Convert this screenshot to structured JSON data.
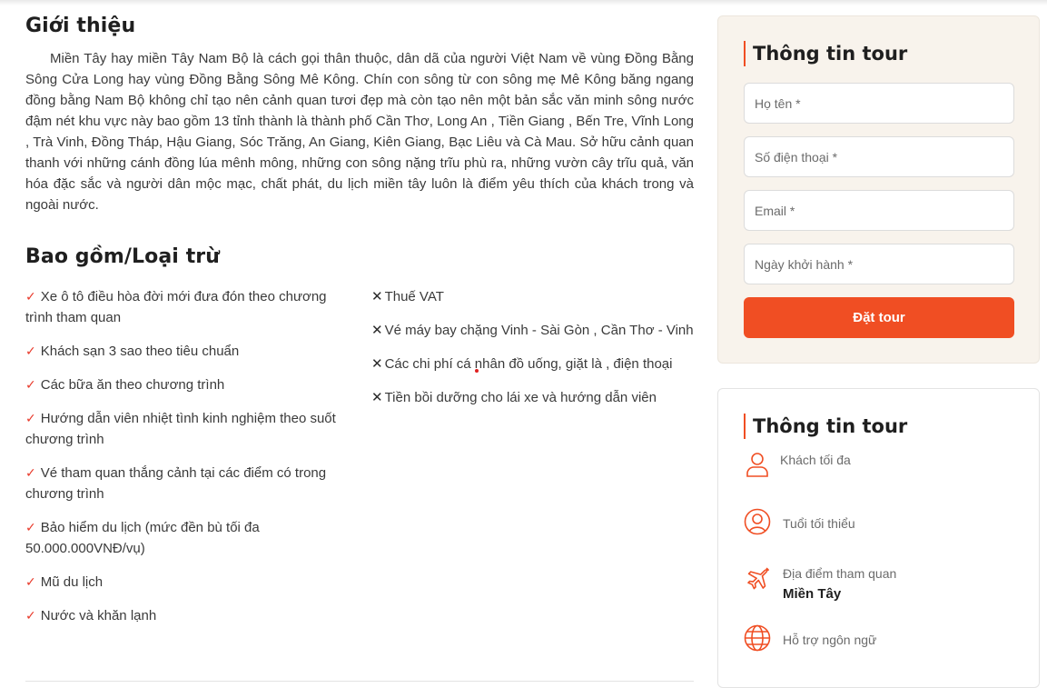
{
  "intro": {
    "title": "Giới thiệu",
    "text": "Miền Tây hay miền Tây Nam Bộ là cách gọi thân thuộc, dân dã của người Việt Nam về vùng Đồng Bằng Sông Cửa Long hay vùng Đồng Bằng Sông Mê Kông. Chín con sông  từ con sông mẹ Mê Kông băng ngang đồng bằng Nam Bộ không chỉ tạo nên cảnh quan tươi đẹp mà còn tạo nên một bản sắc văn minh sông nước đậm nét khu vực này bao gồm 13 tỉnh thành là thành phố Cần Thơ, Long An , Tiền Giang , Bến Tre, Vĩnh Long , Trà Vinh, Đồng Tháp, Hậu Giang, Sóc Trăng, An Giang, Kiên Giang, Bạc Liêu  và Cà Mau. Sở hữu cảnh quan thanh với những cánh đồng lúa mênh mông, những con sông nặng trĩu phù ra, những vườn cây trĩu quả, văn hóa đặc sắc và người dân mộc mạc, chất phát, du lịch miền tây luôn là điểm yêu thích của khách trong và ngoài nước."
  },
  "inclusions": {
    "title": "Bao gồm/Loại trừ",
    "included": [
      "Xe ô tô điều hòa đời mới đưa đón theo chương trình tham quan",
      "Khách sạn 3 sao theo tiêu chuẩn",
      "Các bữa ăn theo chương trình",
      "Hướng dẫn viên nhiệt tình kinh nghiệm theo suốt chương trình",
      "Vé tham quan thắng cảnh tại các điểm có trong chương trình",
      "Bảo hiểm du lịch (mức đền bù tối đa 50.000.000VNĐ/vụ)",
      "Mũ du lịch",
      "Nước và khăn lạnh"
    ],
    "excluded": [
      "Thuế VAT",
      "Vé máy bay chặng Vinh - Sài Gòn , Cần Thơ - Vinh",
      "Các chi phí cá nhân đồ uống, giặt là , điện thoại",
      "Tiền bồi dưỡng cho lái xe và hướng dẫn viên"
    ],
    "check_symbol": "✓",
    "x_symbol": "✕"
  },
  "booking": {
    "title": "Thông tin tour",
    "name_placeholder": "Họ tên *",
    "phone_placeholder": "Số điện thoại *",
    "email_placeholder": "Email *",
    "date_placeholder": "Ngày khởi hành *",
    "submit_label": "Đặt tour"
  },
  "tour_info": {
    "title": "Thông tin tour",
    "rows": [
      {
        "icon": "person-icon",
        "label": "Khách tối đa",
        "value": ""
      },
      {
        "icon": "user-circle-icon",
        "label": "Tuổi tối thiểu",
        "value": ""
      },
      {
        "icon": "airplane-icon",
        "label": "Địa điểm tham quan",
        "value": "Miền Tây"
      },
      {
        "icon": "globe-icon",
        "label": "Hỗ trợ ngôn ngữ",
        "value": ""
      }
    ]
  },
  "colors": {
    "accent": "#f04e23",
    "check": "#e8392a",
    "card_bg": "#f8f3ec"
  }
}
